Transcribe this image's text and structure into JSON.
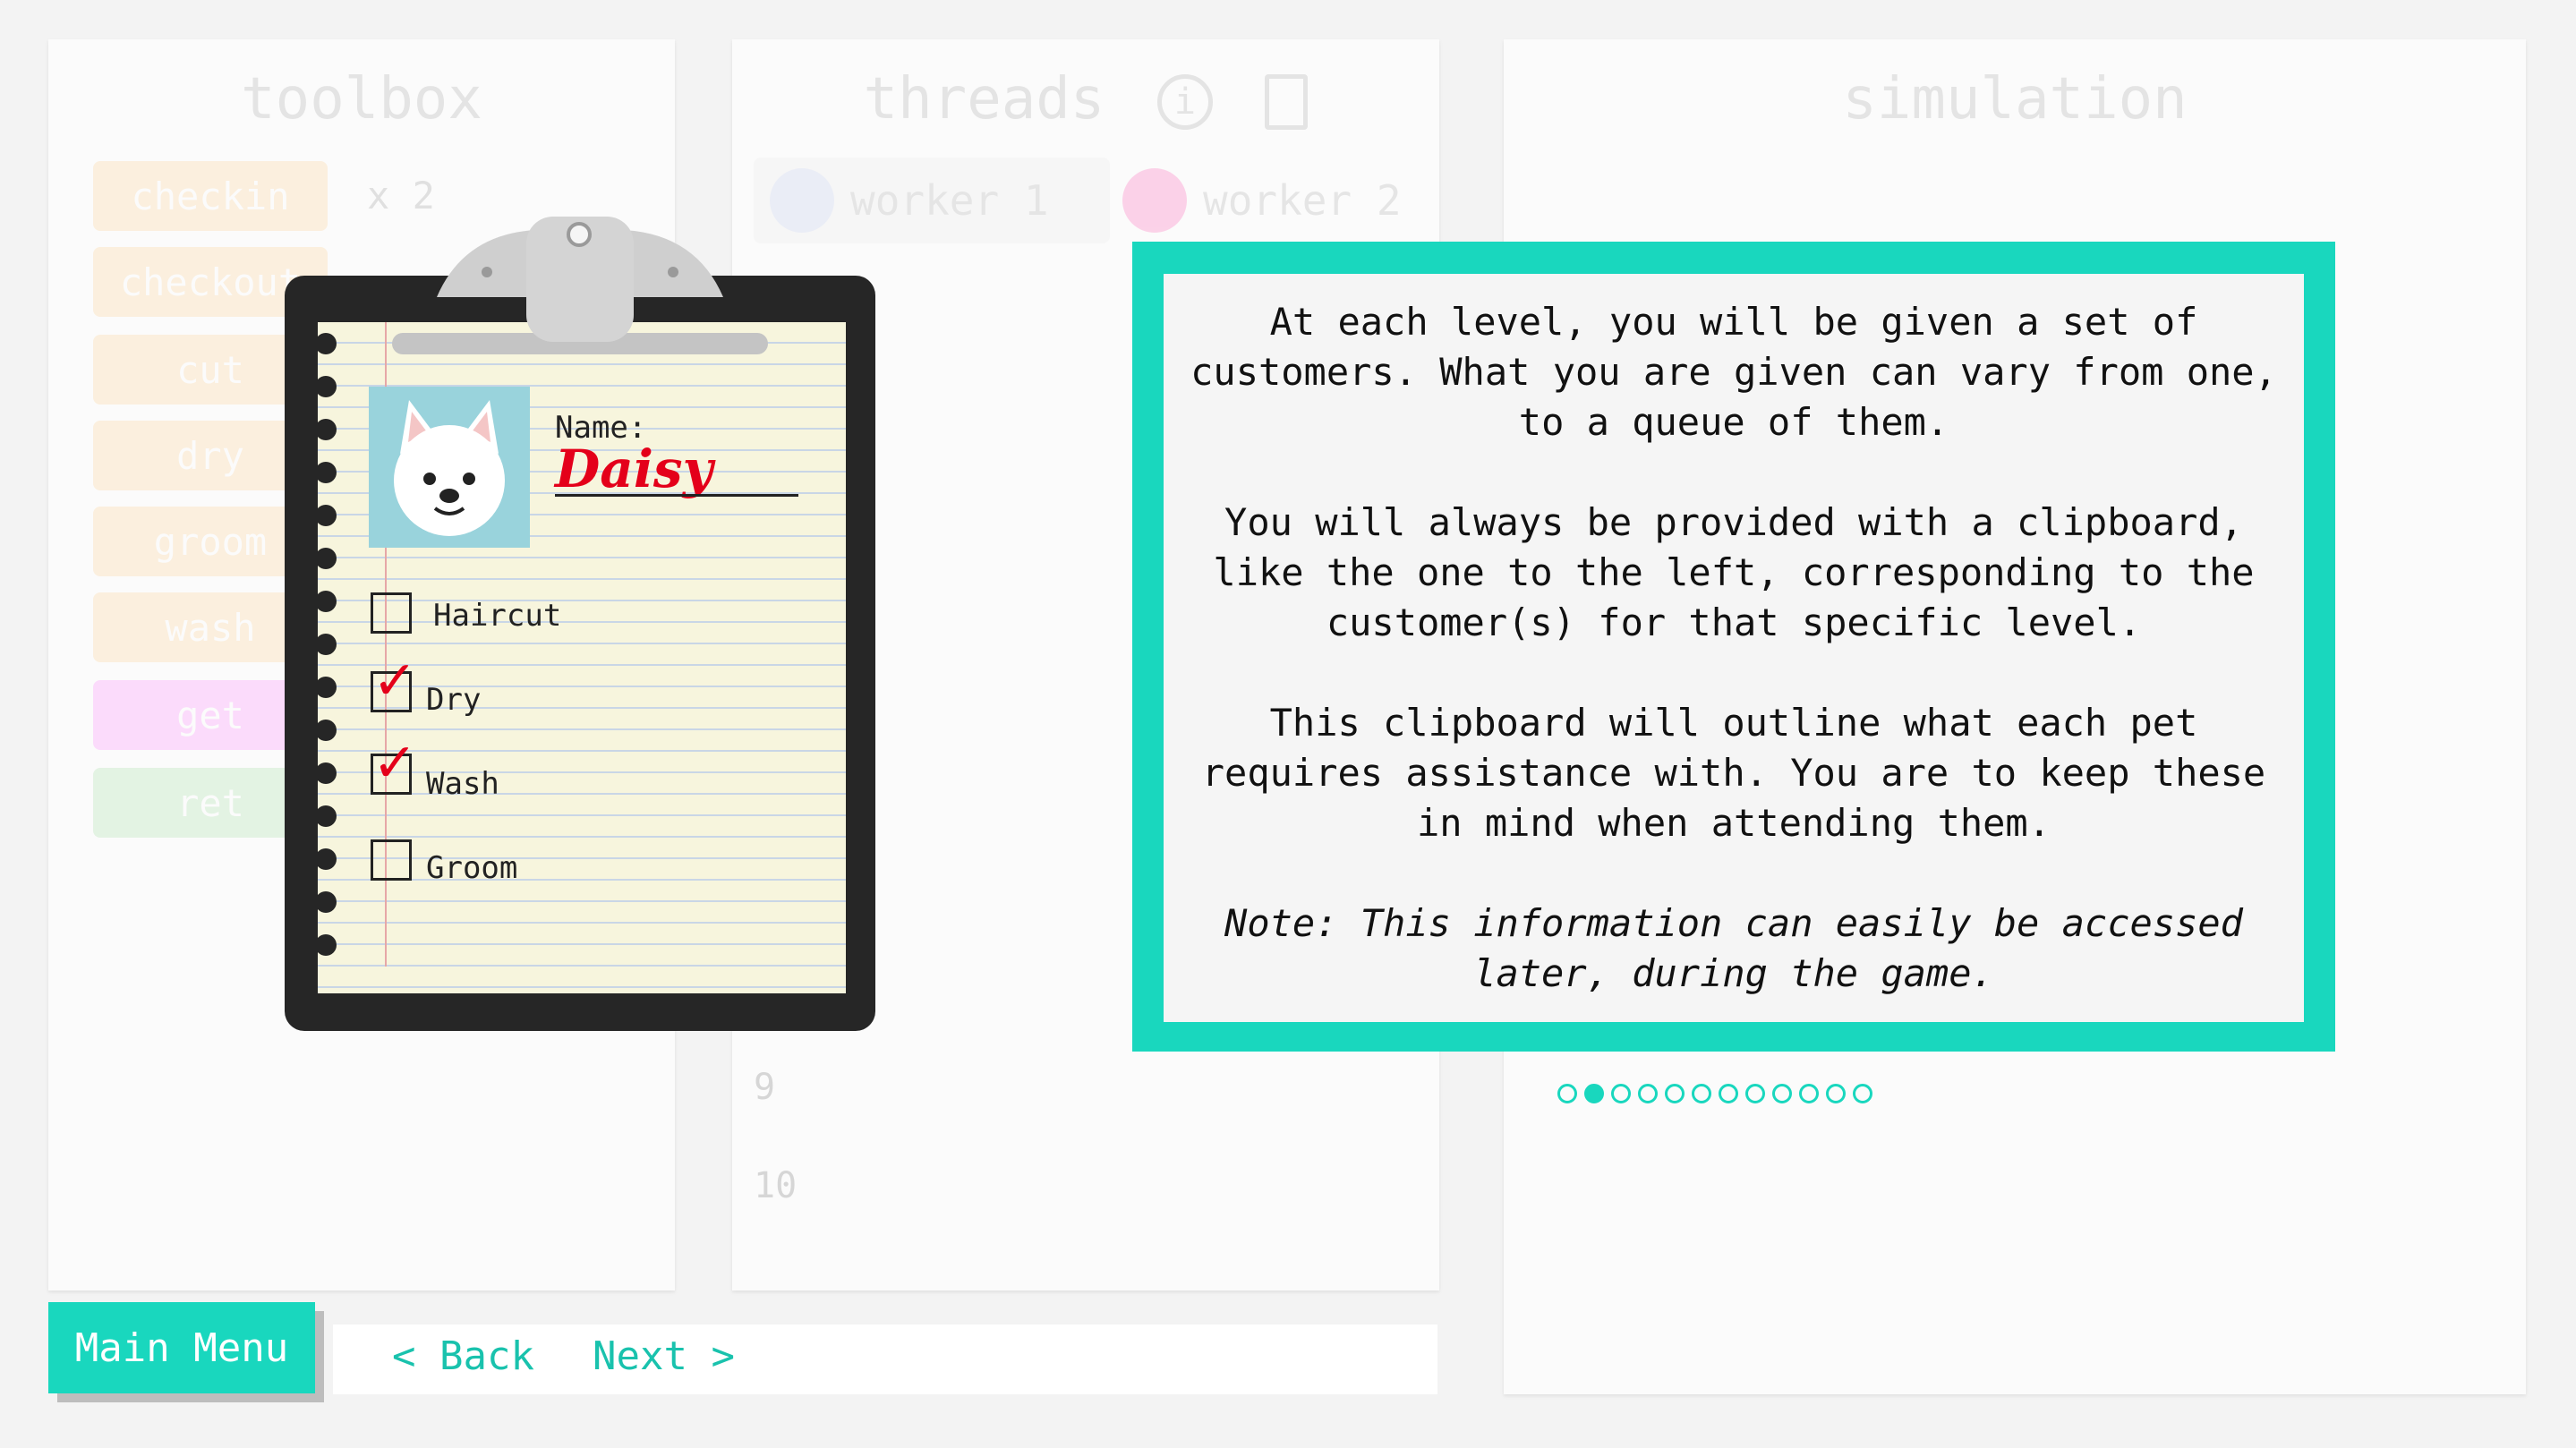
{
  "toolbox": {
    "title": "toolbox",
    "buttons": [
      {
        "label": "checkin",
        "color": "#ffb347"
      },
      {
        "label": "checkout",
        "color": "#ffb347"
      },
      {
        "label": "cut",
        "color": "#ffb347"
      },
      {
        "label": "dry",
        "color": "#ffb347"
      },
      {
        "label": "groom",
        "color": "#ffb347"
      },
      {
        "label": "wash",
        "color": "#ffb347"
      },
      {
        "label": "get",
        "color": "#ff33ff"
      },
      {
        "label": "ret",
        "color": "#66cc66"
      }
    ],
    "count_x2": "x 2"
  },
  "threads": {
    "title": "threads",
    "info_icon": "info-icon",
    "notes_icon": "notes-icon",
    "workers": [
      "worker 1",
      "worker 2"
    ],
    "line_numbers": [
      "9",
      "10"
    ]
  },
  "simulation": {
    "title": "simulation"
  },
  "clipboard": {
    "name_label": "Name:",
    "name_value": "Daisy",
    "tasks": [
      {
        "label": "Haircut",
        "checked": false
      },
      {
        "label": "Dry",
        "checked": true
      },
      {
        "label": "Wash",
        "checked": true
      },
      {
        "label": "Groom",
        "checked": false
      }
    ],
    "check_glyph": "✓"
  },
  "dialog": {
    "paragraph1": "At each level, you will be given a set of customers. What you are given can vary from one, to a queue of them.",
    "paragraph2": "You will always be provided with a clipboard, like the one to the left, corresponding to the customer(s) for that specific level.",
    "paragraph3": "This clipboard will outline what each pet requires assistance with. You are to keep these in mind when attending them.",
    "note": "Note: This information can easily be accessed later, during the game.",
    "accent_color": "#19d7be"
  },
  "pagination": {
    "total": 12,
    "current": 2
  },
  "navigation": {
    "main_menu": "Main Menu",
    "back": "< Back",
    "next": "Next >"
  }
}
